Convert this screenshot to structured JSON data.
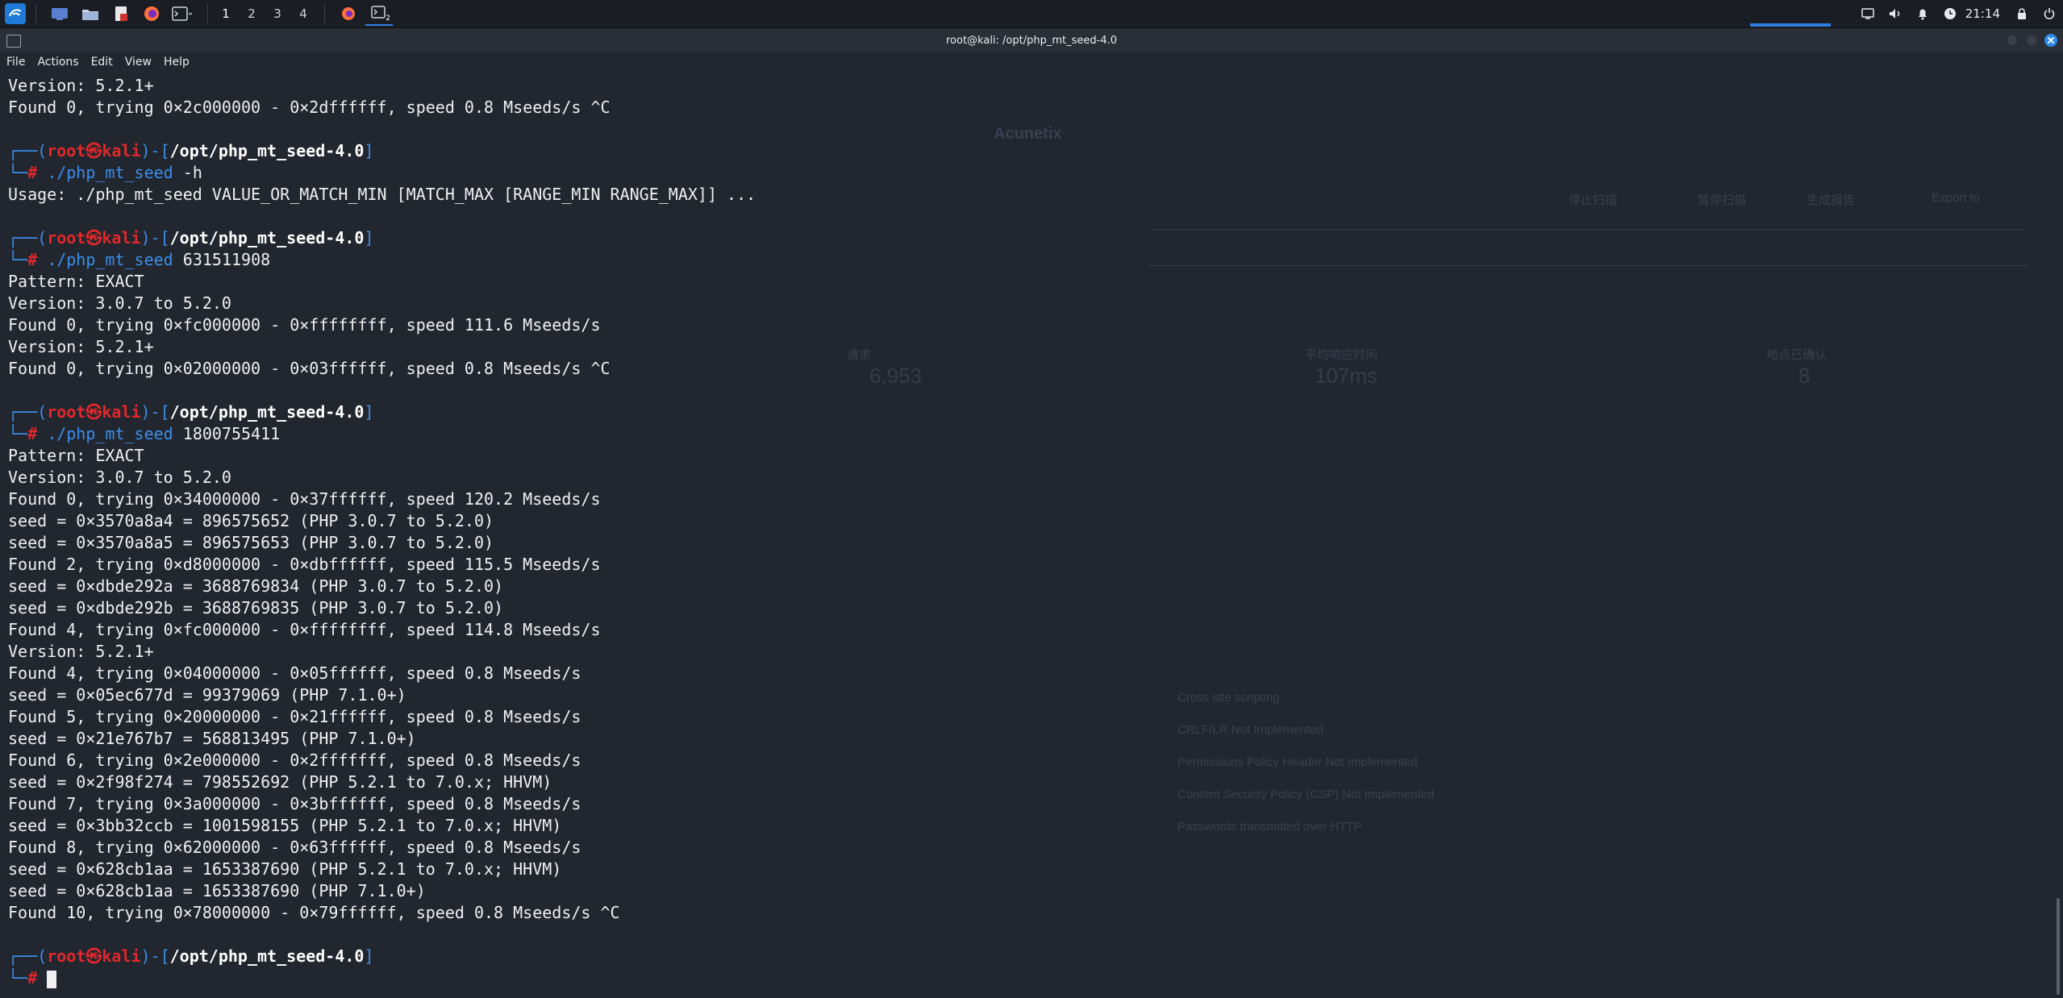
{
  "panel": {
    "workspaces": [
      "1",
      "2",
      "3",
      "4"
    ],
    "active_workspace": "1",
    "launcher_icons": [
      "kali-menu-icon",
      "desktop-icon",
      "file-manager-icon",
      "text-editor-icon",
      "firefox-icon",
      "terminal-icon"
    ],
    "task_icons": [
      "firefox-task-icon",
      "terminal-task-icon"
    ],
    "terminal_task_badge": "2",
    "clock": "21:14"
  },
  "window": {
    "title": "root@kali: /opt/php_mt_seed-4.0",
    "menu": [
      "File",
      "Actions",
      "Edit",
      "View",
      "Help"
    ]
  },
  "prompt": {
    "open": "┌──(",
    "user": "root",
    "at": "㉿",
    "host": "kali",
    "mid": ")-[",
    "path": "/opt/php_mt_seed-4.0",
    "close": "]",
    "lower": "└─",
    "hash": "#"
  },
  "terminal": [
    {
      "type": "out",
      "text": "Version: 5.2.1+"
    },
    {
      "type": "out",
      "text": "Found 0, trying 0×2c000000 - 0×2dffffff, speed 0.8 Mseeds/s ^C"
    },
    {
      "type": "blank"
    },
    {
      "type": "prompt",
      "cmd": "./php_mt_seed",
      "args": " -h"
    },
    {
      "type": "out",
      "text": "Usage: ./php_mt_seed VALUE_OR_MATCH_MIN [MATCH_MAX [RANGE_MIN RANGE_MAX]] ..."
    },
    {
      "type": "blank"
    },
    {
      "type": "prompt",
      "cmd": "./php_mt_seed",
      "args": " 631511908"
    },
    {
      "type": "out",
      "text": "Pattern: EXACT"
    },
    {
      "type": "out",
      "text": "Version: 3.0.7 to 5.2.0"
    },
    {
      "type": "out",
      "text": "Found 0, trying 0×fc000000 - 0×ffffffff, speed 111.6 Mseeds/s"
    },
    {
      "type": "out",
      "text": "Version: 5.2.1+"
    },
    {
      "type": "out",
      "text": "Found 0, trying 0×02000000 - 0×03ffffff, speed 0.8 Mseeds/s ^C"
    },
    {
      "type": "blank"
    },
    {
      "type": "prompt",
      "cmd": "./php_mt_seed",
      "args": " 1800755411"
    },
    {
      "type": "out",
      "text": "Pattern: EXACT"
    },
    {
      "type": "out",
      "text": "Version: 3.0.7 to 5.2.0"
    },
    {
      "type": "out",
      "text": "Found 0, trying 0×34000000 - 0×37ffffff, speed 120.2 Mseeds/s"
    },
    {
      "type": "out",
      "text": "seed = 0×3570a8a4 = 896575652 (PHP 3.0.7 to 5.2.0)"
    },
    {
      "type": "out",
      "text": "seed = 0×3570a8a5 = 896575653 (PHP 3.0.7 to 5.2.0)"
    },
    {
      "type": "out",
      "text": "Found 2, trying 0×d8000000 - 0×dbffffff, speed 115.5 Mseeds/s"
    },
    {
      "type": "out",
      "text": "seed = 0×dbde292a = 3688769834 (PHP 3.0.7 to 5.2.0)"
    },
    {
      "type": "out",
      "text": "seed = 0×dbde292b = 3688769835 (PHP 3.0.7 to 5.2.0)"
    },
    {
      "type": "out",
      "text": "Found 4, trying 0×fc000000 - 0×ffffffff, speed 114.8 Mseeds/s"
    },
    {
      "type": "out",
      "text": "Version: 5.2.1+"
    },
    {
      "type": "out",
      "text": "Found 4, trying 0×04000000 - 0×05ffffff, speed 0.8 Mseeds/s"
    },
    {
      "type": "out",
      "text": "seed = 0×05ec677d = 99379069 (PHP 7.1.0+)"
    },
    {
      "type": "out",
      "text": "Found 5, trying 0×20000000 - 0×21ffffff, speed 0.8 Mseeds/s"
    },
    {
      "type": "out",
      "text": "seed = 0×21e767b7 = 568813495 (PHP 7.1.0+)"
    },
    {
      "type": "out",
      "text": "Found 6, trying 0×2e000000 - 0×2fffffff, speed 0.8 Mseeds/s"
    },
    {
      "type": "out",
      "text": "seed = 0×2f98f274 = 798552692 (PHP 5.2.1 to 7.0.x; HHVM)"
    },
    {
      "type": "out",
      "text": "Found 7, trying 0×3a000000 - 0×3bffffff, speed 0.8 Mseeds/s"
    },
    {
      "type": "out",
      "text": "seed = 0×3bb32ccb = 1001598155 (PHP 5.2.1 to 7.0.x; HHVM)"
    },
    {
      "type": "out",
      "text": "Found 8, trying 0×62000000 - 0×63ffffff, speed 0.8 Mseeds/s"
    },
    {
      "type": "out",
      "text": "seed = 0×628cb1aa = 1653387690 (PHP 5.2.1 to 7.0.x; HHVM)"
    },
    {
      "type": "out",
      "text": "seed = 0×628cb1aa = 1653387690 (PHP 7.1.0+)"
    },
    {
      "type": "out",
      "text": "Found 10, trying 0×78000000 - 0×79ffffff, speed 0.8 Mseeds/s ^C"
    },
    {
      "type": "blank"
    },
    {
      "type": "prompt_active"
    }
  ],
  "background_window": {
    "app_title": "Acunetix",
    "stats": [
      {
        "label": "请求",
        "value": "6,953"
      },
      {
        "label": "平均响应时间",
        "value": "107ms"
      },
      {
        "label": "地点已确认",
        "value": "8"
      }
    ],
    "vuln_items": [
      "Cross site scripting",
      "CRLF/LR Not Implemented",
      "Permissions Policy Header Not Implemented",
      "Content Security Policy (CSP) Not Implemented",
      "Passwords transmitted over HTTP"
    ],
    "buttons": [
      "停止扫描",
      "暂停扫描",
      "生成报告",
      "Export to"
    ]
  },
  "colors": {
    "panel_bg": "#1a1d24",
    "terminal_bg": "#22262f",
    "prompt_blue": "#3b8eea",
    "prompt_red": "#e0272a",
    "text": "#f0f0f0"
  }
}
